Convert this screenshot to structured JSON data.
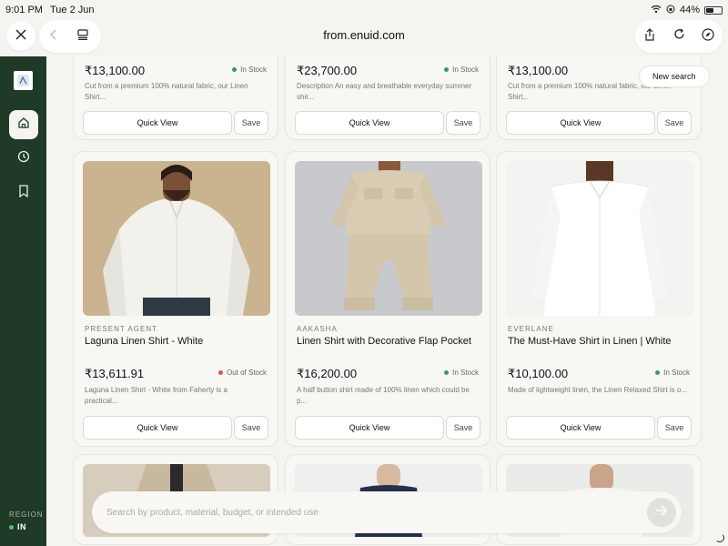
{
  "status_bar": {
    "time": "9:01 PM",
    "date": "Tue 2 Jun",
    "battery": "44%"
  },
  "browser": {
    "url": "from.enuid.com"
  },
  "sidebar": {
    "region_label": "REGION",
    "region_value": "IN"
  },
  "new_search_label": "New search",
  "top_row": [
    {
      "price": "₹13,100.00",
      "stock": "In Stock",
      "desc_line1": "Cut from a premium 100% natural fabric, our Linen",
      "desc_line2": "Shirt...",
      "quick_view": "Quick View",
      "save": "Save"
    },
    {
      "price": "₹23,700.00",
      "stock": "In Stock",
      "desc_line1": "Description An easy and breathable everyday summer",
      "desc_line2": "shir...",
      "quick_view": "Quick View",
      "save": "Save"
    },
    {
      "price": "₹13,100.00",
      "stock": "In Stock",
      "desc_line1": "Cut from a premium 100% natural fabric, our Linen",
      "desc_line2": "Shirt...",
      "quick_view": "Quick View",
      "save": "Save"
    }
  ],
  "mid_row": [
    {
      "brand": "PRESENT AGENT",
      "title": "Laguna Linen Shirt - White",
      "price": "₹13,611.91",
      "stock": "Out of Stock",
      "desc_line1": "Laguna Linen Shirt - White from Faherty is a",
      "desc_line2": "practical...",
      "quick_view": "Quick View",
      "save": "Save"
    },
    {
      "brand": "AAKASHA",
      "title": "Linen Shirt with Decorative Flap Pocket",
      "price": "₹16,200.00",
      "stock": "In Stock",
      "desc_line1": "A half button shirt made of 100% linen which could be",
      "desc_line2": "p...",
      "quick_view": "Quick View",
      "save": "Save"
    },
    {
      "brand": "EVERLANE",
      "title": "The Must-Have Shirt in Linen | White",
      "price": "₹10,100.00",
      "stock": "In Stock",
      "desc_line1": "Made of lightweight linen, the Linen Relaxed Shirt is o...",
      "desc_line2": "",
      "quick_view": "Quick View",
      "save": "Save"
    }
  ],
  "search": {
    "placeholder": "Search by product, material, budget, or intended use"
  },
  "colors": {
    "sidebar_bg": "#1f3a26",
    "page_bg": "#f5f4f0",
    "in_stock": "#3a9b57",
    "out_of_stock": "#d9534f"
  },
  "icons": [
    "close-icon",
    "back-icon",
    "reader-icon",
    "share-icon",
    "reload-icon",
    "compass-icon",
    "home-icon",
    "history-icon",
    "bookmark-icon",
    "send-arrow-icon"
  ]
}
